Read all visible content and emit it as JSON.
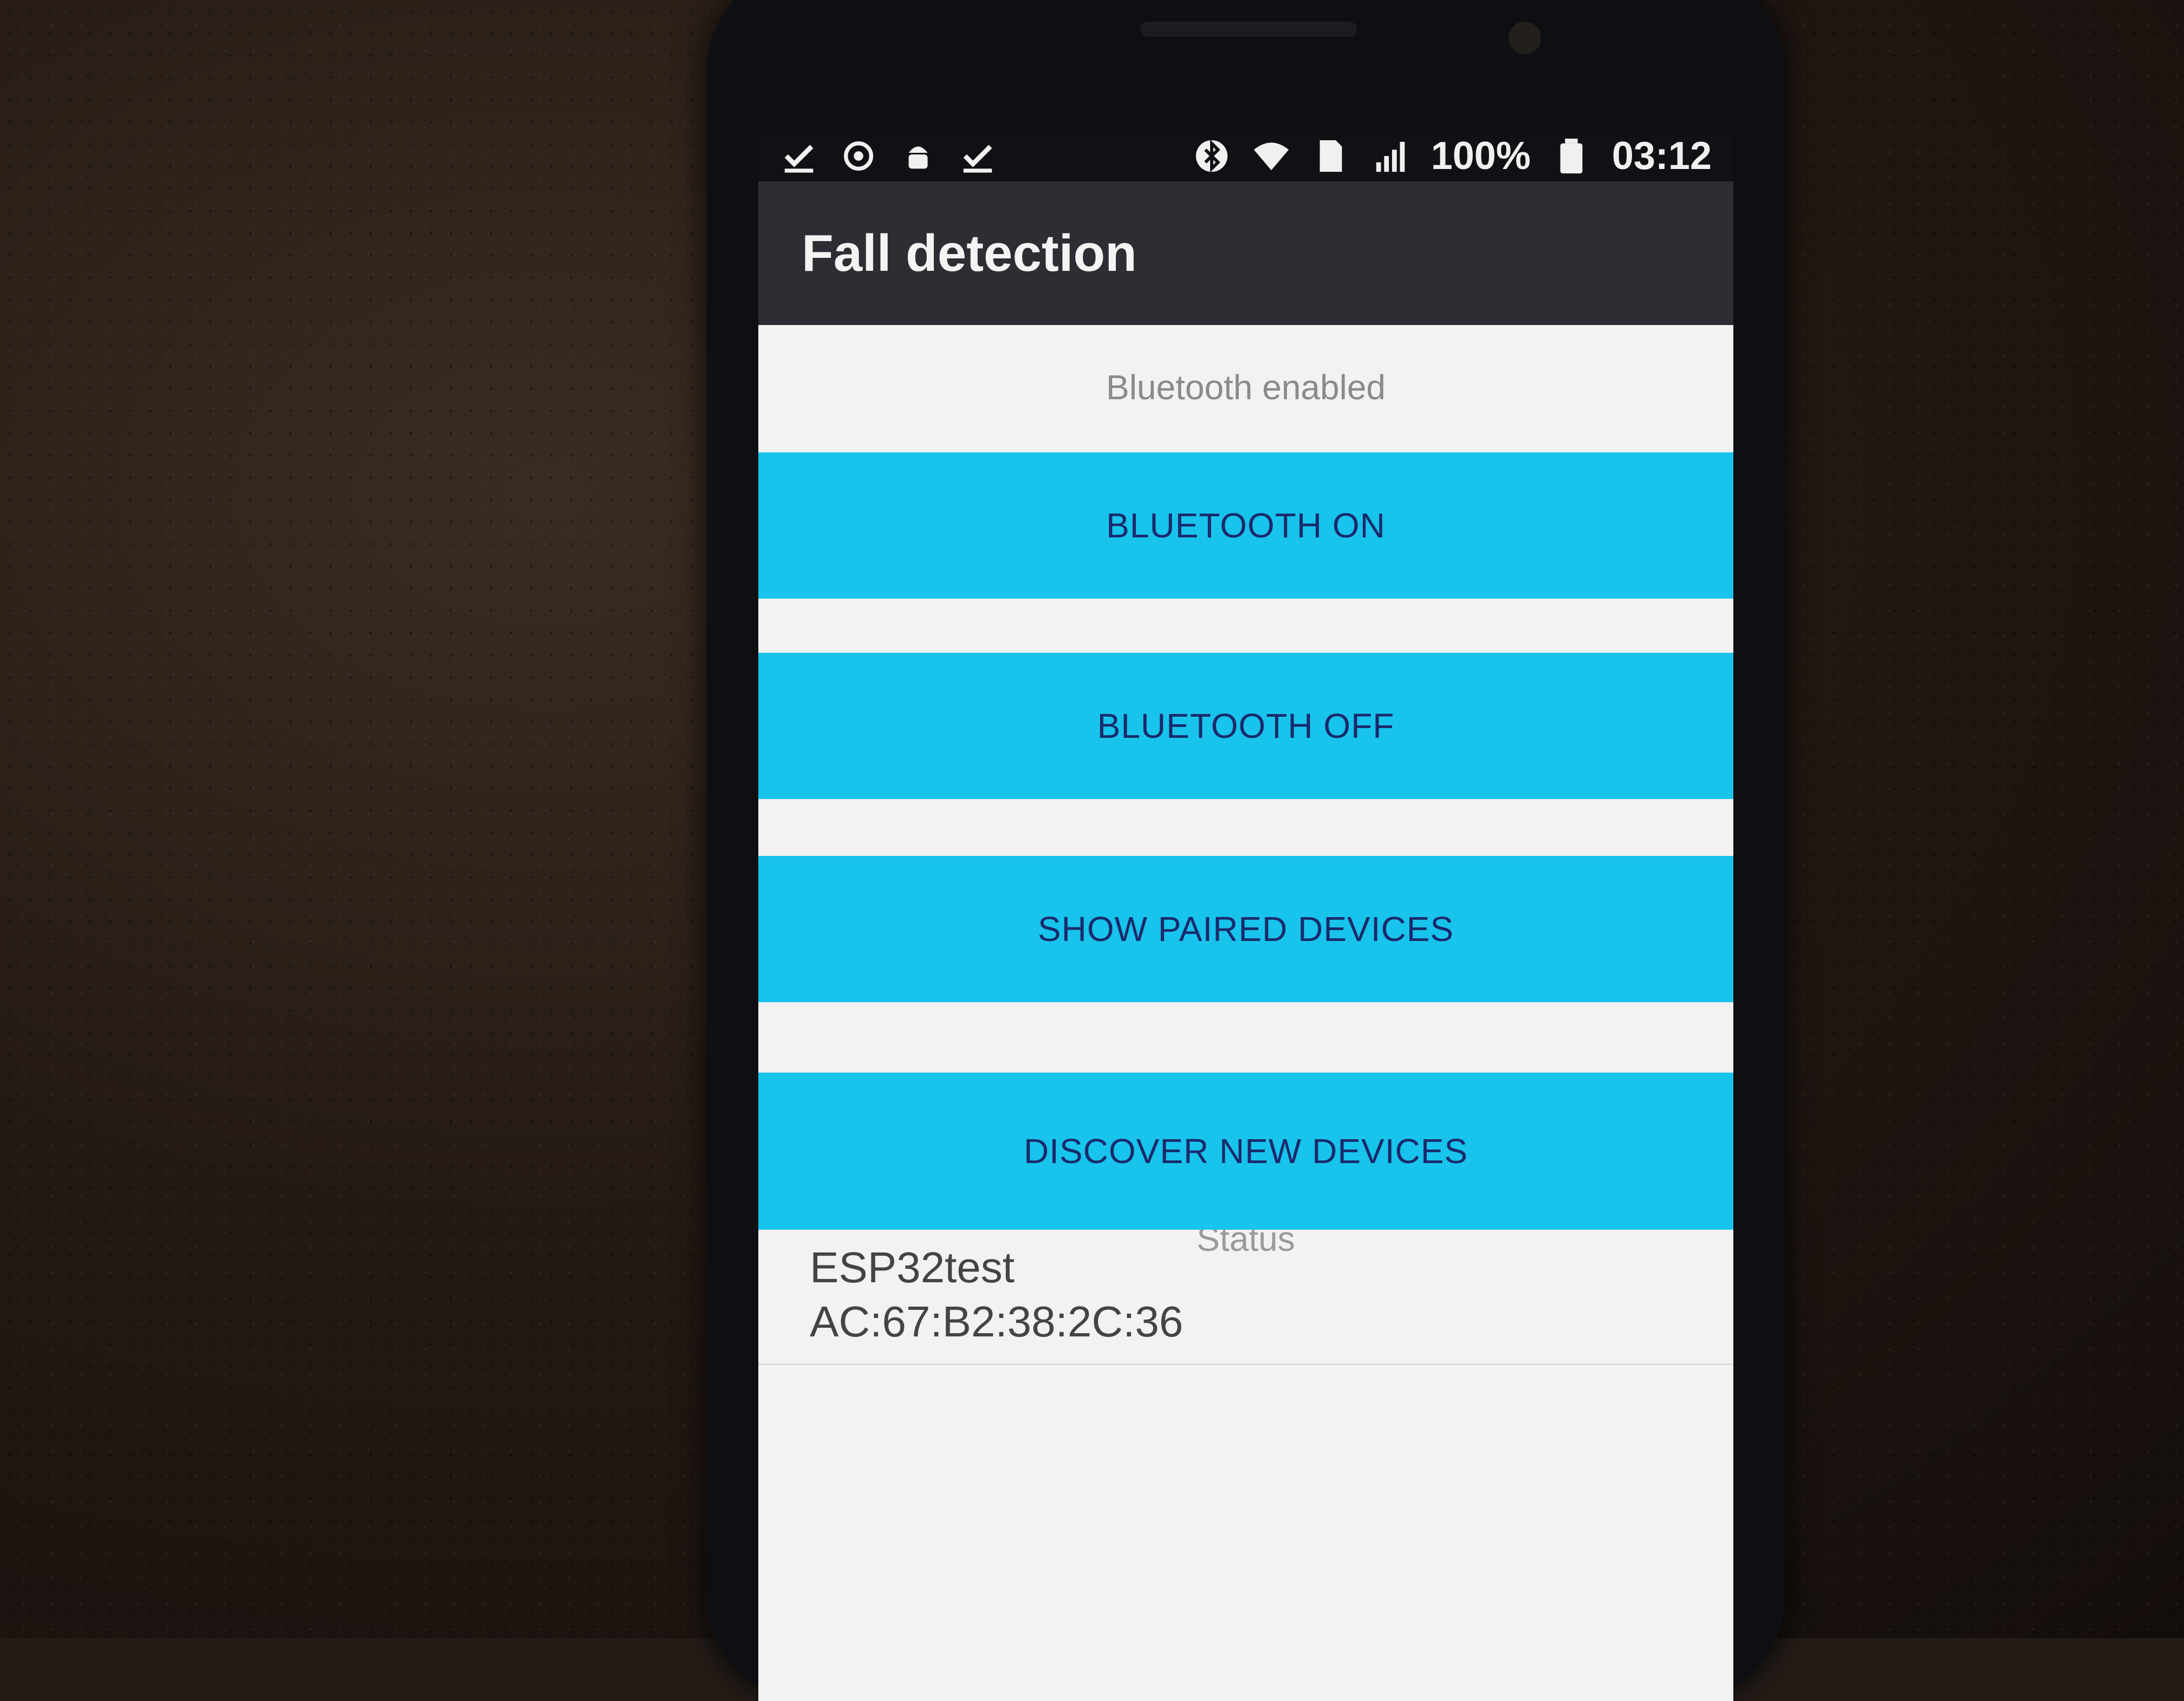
{
  "status_bar": {
    "left_icons": [
      "download-done-icon",
      "sync-icon",
      "android-debug-icon",
      "download-done-icon"
    ],
    "right_icons": [
      "bluetooth-icon",
      "wifi-icon",
      "sim-icon",
      "signal-icon"
    ],
    "battery": "100%",
    "time": "03:12"
  },
  "app_bar": {
    "title": "Fall detection"
  },
  "main": {
    "bluetooth_status": "Bluetooth enabled",
    "buttons": {
      "on": "BLUETOOTH ON",
      "off": "BLUETOOTH OFF",
      "paired": "SHOW PAIRED DEVICES",
      "discover": "DISCOVER NEW DEVICES"
    },
    "status_label": "Status",
    "devices": [
      {
        "name": "ESP32test",
        "mac": "AC:67:B2:38:2C:36"
      }
    ]
  },
  "colors": {
    "button_bg": "#18c3ec",
    "button_text": "#1a2a6b",
    "app_bar": "#2c2e33",
    "status_bar": "#0f1114"
  }
}
